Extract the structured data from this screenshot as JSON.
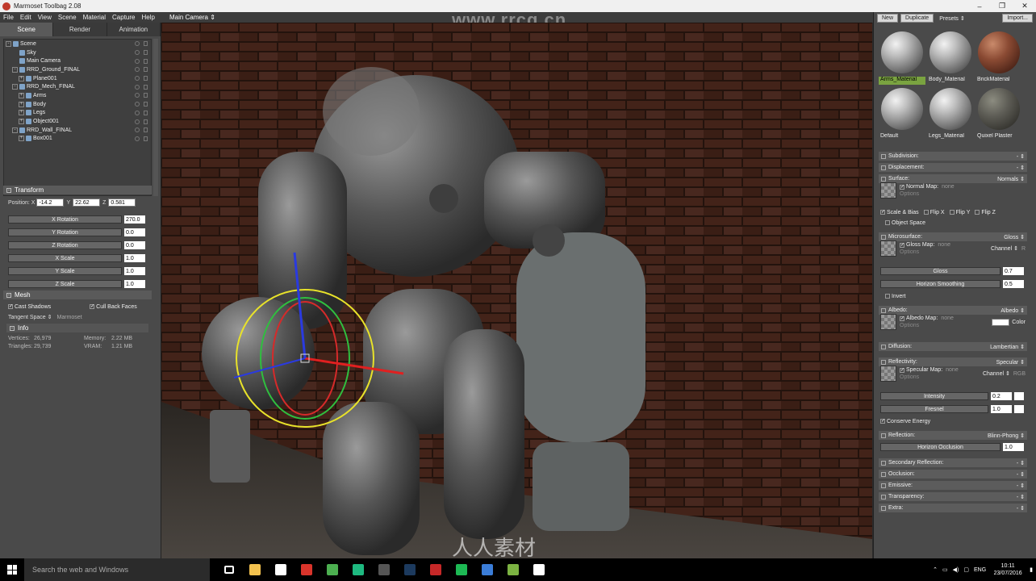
{
  "window": {
    "title": "Marmoset Toolbag 2.08",
    "controls": [
      "–",
      "❐",
      "✕"
    ]
  },
  "menu": {
    "items": [
      "File",
      "Edit",
      "View",
      "Scene",
      "Material",
      "Capture",
      "Help"
    ],
    "camera": "Main Camera ⇕"
  },
  "watermark": {
    "text": "www.rrcg.cn",
    "bottom": "人人素材"
  },
  "left": {
    "tabs": [
      "Scene",
      "Render",
      "Animation"
    ],
    "outliner": [
      {
        "label": "Scene",
        "indent": 0,
        "toggle": "-"
      },
      {
        "label": "Sky",
        "indent": 1,
        "toggle": ""
      },
      {
        "label": "Main Camera",
        "indent": 1,
        "toggle": ""
      },
      {
        "label": "RRD_Ground_FINAL",
        "indent": 1,
        "toggle": "-"
      },
      {
        "label": "Plane001",
        "indent": 2,
        "toggle": "+"
      },
      {
        "label": "RRD_Mech_FINAL",
        "indent": 1,
        "toggle": "-"
      },
      {
        "label": "Arms",
        "indent": 2,
        "toggle": "+"
      },
      {
        "label": "Body",
        "indent": 2,
        "toggle": "+"
      },
      {
        "label": "Legs",
        "indent": 2,
        "toggle": "+"
      },
      {
        "label": "Object001",
        "indent": 2,
        "toggle": "+"
      },
      {
        "label": "RRD_Wall_FINAL",
        "indent": 1,
        "toggle": "-"
      },
      {
        "label": "Box001",
        "indent": 2,
        "toggle": "+"
      }
    ],
    "transform": {
      "title": "Transform",
      "position_label": "Position: X",
      "x": "-14.2",
      "y_label": "Y",
      "y": "22.62",
      "z_label": "Z",
      "z": "0.581",
      "rows": [
        {
          "label": "X Rotation",
          "value": "270.0"
        },
        {
          "label": "Y Rotation",
          "value": "0.0"
        },
        {
          "label": "Z Rotation",
          "value": "0.0"
        },
        {
          "label": "X Scale",
          "value": "1.0"
        },
        {
          "label": "Y Scale",
          "value": "1.0"
        },
        {
          "label": "Z Scale",
          "value": "1.0"
        }
      ]
    },
    "mesh": {
      "title": "Mesh",
      "cast_shadows": "Cast Shadows",
      "cull_back": "Cull Back Faces",
      "tangent_label": "Tangent Space ⇕",
      "tangent_value": "Marmoset",
      "info_title": "Info",
      "vertices_label": "Vertices:",
      "vertices": "26,979",
      "memory_label": "Memory:",
      "memory": "2.22 MB",
      "triangles_label": "Triangles:",
      "triangles": "29,739",
      "vram_label": "VRAM:",
      "vram": "1.21 MB"
    }
  },
  "right": {
    "buttons": {
      "new": "New",
      "duplicate": "Duplicate",
      "presets": "Presets ⇕",
      "import": "Import..."
    },
    "materials": [
      {
        "label": "Arms_Material",
        "kind": "gray",
        "selected": true
      },
      {
        "label": "Body_Material",
        "kind": "gray",
        "selected": false
      },
      {
        "label": "BrickMaterial",
        "kind": "brick",
        "selected": false
      },
      {
        "label": "Default",
        "kind": "gray",
        "selected": false
      },
      {
        "label": "Legs_Material",
        "kind": "gray",
        "selected": false
      },
      {
        "label": "Quixel Plaster",
        "kind": "plaster",
        "selected": false
      }
    ],
    "sections": {
      "subdivision": "Subdivision:",
      "displacement": "Displacement:",
      "surface": "Surface:",
      "surface_val": "Normals ⇕",
      "normal_map": "Normal Map:",
      "none": "none",
      "options": "Options",
      "scale_bias": "Scale & Bias",
      "flip_x": "Flip X",
      "flip_y": "Flip Y",
      "flip_z": "Flip Z",
      "object_space": "Object Space",
      "microsurface": "Microsurface:",
      "micro_val": "Gloss ⇕",
      "gloss_map": "Gloss Map:",
      "channel": "Channel ⇕",
      "channel_r": "R",
      "gloss": "Gloss",
      "gloss_val": "0.7",
      "horizon_smoothing": "Horizon Smoothing",
      "horizon_val": "0.5",
      "invert": "Invert",
      "albedo": "Albedo:",
      "albedo_val": "Albedo ⇕",
      "albedo_map": "Albedo Map:",
      "color": "Color",
      "diffusion": "Diffusion:",
      "diffusion_val": "Lambertian ⇕",
      "reflectivity": "Reflectivity:",
      "reflectivity_val": "Specular ⇕",
      "specular_map": "Specular Map:",
      "channel_rgb": "RGB",
      "intensity": "Intensity",
      "intensity_val": "0.2",
      "fresnel": "Fresnel",
      "fresnel_val": "1.0",
      "conserve": "Conserve Energy",
      "reflection": "Reflection:",
      "reflection_val": "Blinn-Phong ⇕",
      "horizon_occlusion": "Horizon Occlusion",
      "ho_val": "1.0",
      "secondary": "Secondary Reflection:",
      "occlusion": "Occlusion:",
      "emissive": "Emissive:",
      "transparency": "Transparency:",
      "extra": "Extra:",
      "dash": "- ⇕"
    }
  },
  "taskbar": {
    "search": "Search the web and Windows",
    "lang": "ENG",
    "time": "10:11",
    "date": "23/07/2016",
    "apps": [
      {
        "name": "task-view-icon",
        "color": "#ffffff"
      },
      {
        "name": "file-explorer-icon",
        "color": "#f2c14e"
      },
      {
        "name": "store-icon",
        "color": "#ffffff"
      },
      {
        "name": "app-red-icon",
        "color": "#d9342b"
      },
      {
        "name": "chrome-icon",
        "color": "#4caf50"
      },
      {
        "name": "app-green-icon",
        "color": "#1eb980"
      },
      {
        "name": "marmoset-icon",
        "color": "#555555"
      },
      {
        "name": "photoshop-icon",
        "color": "#1c3a5e"
      },
      {
        "name": "app-red2-icon",
        "color": "#c62828"
      },
      {
        "name": "spotify-icon",
        "color": "#1db954"
      },
      {
        "name": "app-globe-icon",
        "color": "#3b7dd8"
      },
      {
        "name": "app-lime-icon",
        "color": "#7cb342"
      },
      {
        "name": "app-white-icon",
        "color": "#ffffff"
      }
    ]
  }
}
